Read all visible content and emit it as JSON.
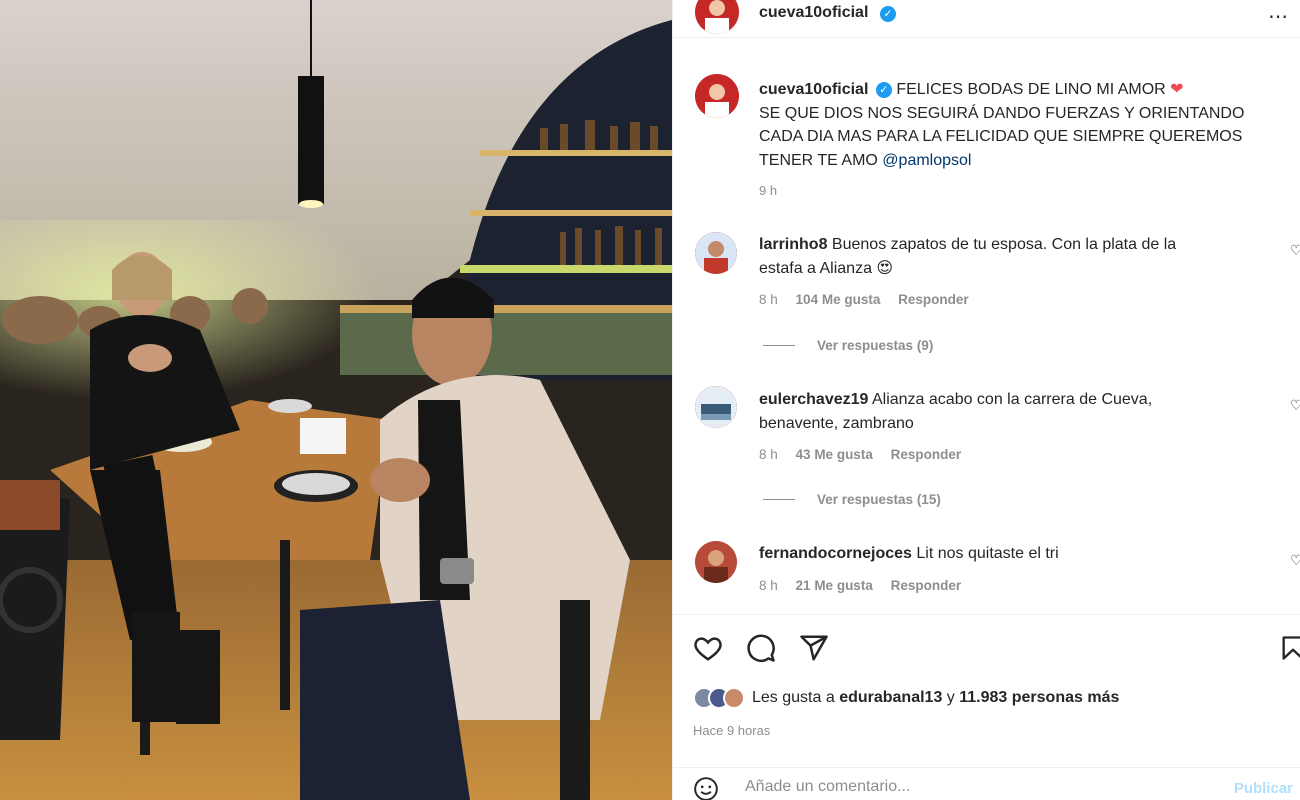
{
  "header": {
    "username": "cueva10oficial"
  },
  "caption": {
    "username": "cueva10oficial",
    "line1": "FELICES BODAS DE LINO MI AMOR",
    "line2": "SE QUE DIOS NOS SEGUIRÁ DANDO FUERZAS Y ORIENTANDO",
    "line3": "CADA DIA MAS PARA LA FELICIDAD QUE SIEMPRE QUEREMOS",
    "line4": "TENER TE AMO",
    "mention": "@pamlopsol",
    "time": "9 h"
  },
  "comments": [
    {
      "username": "larrinho8",
      "text1": "Buenos zapatos de tu esposa. Con la plata de la",
      "text2": "estafa a Alianza",
      "emoji": "😍",
      "time": "8 h",
      "likes": "104 Me gusta",
      "reply": "Responder",
      "view_replies": "Ver respuestas (9)"
    },
    {
      "username": "eulerchavez19",
      "text1": "Alianza acabo con la carrera de Cueva,",
      "text2": "benavente, zambrano",
      "time": "8 h",
      "likes": "43 Me gusta",
      "reply": "Responder",
      "view_replies": "Ver respuestas (15)"
    },
    {
      "username": "fernandocornejoces",
      "text1": "Lit nos quitaste el tri",
      "time": "8 h",
      "likes": "21 Me gusta",
      "reply": "Responder"
    }
  ],
  "likes": {
    "prefix": "Les gusta a",
    "user": "edurabanal13",
    "joiner": "y",
    "others": "11.983 personas más"
  },
  "posted_ago": "Hace 9 horas",
  "add_comment": {
    "placeholder": "Añade un comentario...",
    "publish": "Publicar"
  },
  "icons": {
    "like": "heart-icon",
    "comment": "comment-icon",
    "share": "share-icon",
    "save": "bookmark-icon",
    "emoji": "emoji-icon",
    "more": "more-icon",
    "verified": "verified-badge-icon"
  },
  "colors": {
    "verified": "#1d9bf0",
    "heart": "#ed4956",
    "mention": "#00376b",
    "muted": "#8e8e8e",
    "publish": "#b2dffc"
  }
}
